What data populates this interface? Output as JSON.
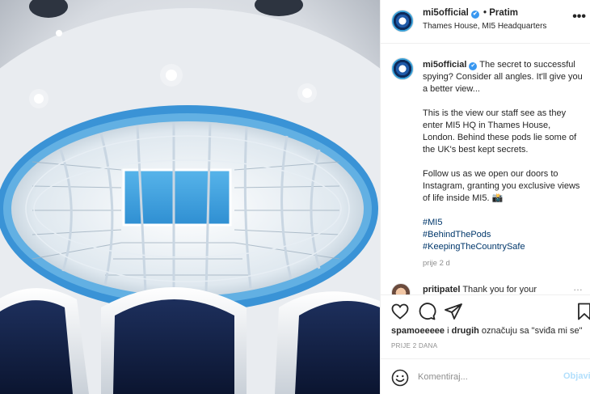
{
  "header": {
    "username": "mi5official",
    "follow_label": "Pratim",
    "dot": "•",
    "location": "Thames House, MI5 Headquarters",
    "more": "•••",
    "verified_mark": "✔"
  },
  "caption": {
    "username": "mi5official",
    "lines": [
      "The secret to successful spying? Consider all angles. It'll give you a better view...",
      "This is the view our staff see as they enter MI5 HQ in Thames House, London. Behind these pods lie some of the UK's best kept secrets.",
      "Follow us as we open our doors to Instagram, granting you exclusive views of life inside MI5. 📸"
    ],
    "hashtags": [
      "#MI5",
      "#BehindThePods",
      "#KeepingTheCountrySafe"
    ],
    "age": "prije 2 d"
  },
  "comment": {
    "username": "pritipatel",
    "text": "Thank you for your",
    "more": "…"
  },
  "actions": {
    "icons": [
      "heart-icon",
      "comment-icon",
      "share-icon",
      "bookmark-icon"
    ],
    "likes_user": "spamoeeeee",
    "likes_and": "i",
    "likes_others": "drugih",
    "likes_suffix": "označuju sa \"sviđa mi se\"",
    "posted": "PRIJE 2 DANA"
  },
  "add_comment": {
    "placeholder": "Komentiraj...",
    "post_label": "Objavi"
  },
  "colors": {
    "accent": "#3897f0",
    "link": "#00376b",
    "muted": "#8e8e8e",
    "post_disabled": "#b2dffc",
    "ring_blue": "#3a93d6"
  }
}
